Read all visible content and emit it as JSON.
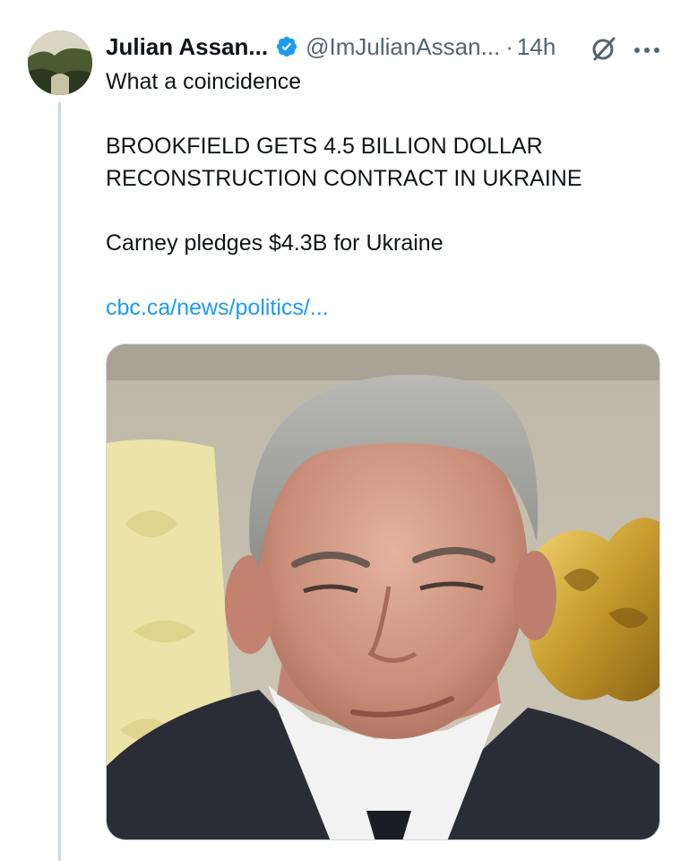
{
  "tweet": {
    "display_name": "Julian Assan...",
    "handle": "@ImJulianAssan...",
    "separator": "·",
    "time": "14h",
    "text_line1": "What a coincidence",
    "headline_line1": "BROOKFIELD GETS 4.5 BILLION DOLLAR",
    "headline_line2": "RECONSTRUCTION CONTRACT IN UKRAINE",
    "pledge": "Carney pledges $4.3B for Ukraine",
    "link": "cbc.ca/news/politics/..."
  },
  "icons": {
    "verified": "verified-badge-icon",
    "grok": "grok-icon",
    "more": "more-options-icon"
  },
  "colors": {
    "text": "#0f1419",
    "secondary": "#536471",
    "link": "#1d9bf0",
    "verified": "#1d9bf0",
    "thread_line": "#cfd9de"
  }
}
